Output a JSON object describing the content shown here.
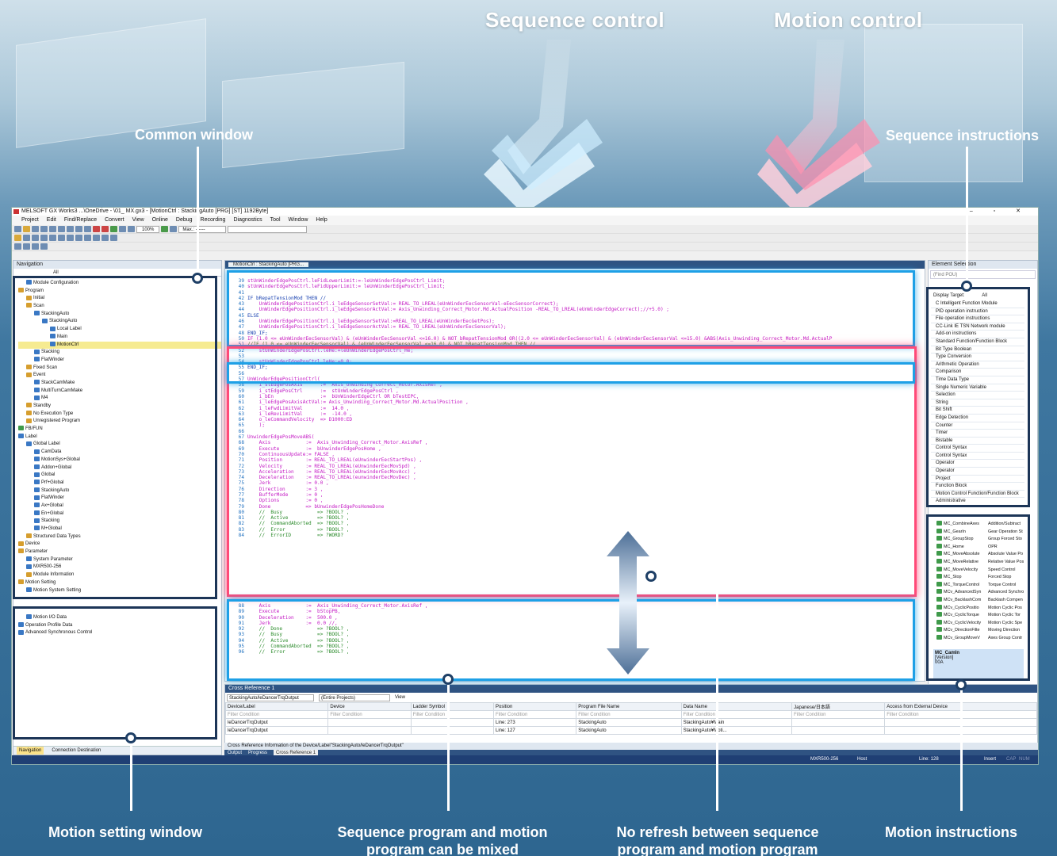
{
  "headings": {
    "sequence_control": "Sequence control",
    "motion_control": "Motion control"
  },
  "callouts": {
    "common_window": "Common window",
    "sequence_instructions": "Sequence instructions",
    "motion_setting_window": "Motion setting window",
    "mixed_program": [
      "Sequence program and motion",
      "program can be mixed"
    ],
    "no_refresh": [
      "No refresh between sequence",
      "program and motion program"
    ],
    "motion_instructions": "Motion instructions"
  },
  "window": {
    "title": "MELSOFT GX Works3 ...\\OneDrive -                    \\01_                      MX.gx3 - [MotionCtrl : StackingAuto [PRG] [ST] 1192Byte]",
    "menu": [
      "Project",
      "Edit",
      "Find/Replace",
      "Convert",
      "View",
      "Online",
      "Debug",
      "Recording",
      "Diagnostics",
      "Tool",
      "Window",
      "Help"
    ],
    "zoom": "100%",
    "max_label": "Max.: ------",
    "controls": [
      "–",
      "▫",
      "✕"
    ]
  },
  "navigation": {
    "title": "Navigation",
    "search": "All",
    "items": [
      {
        "label": "Module Configuration",
        "indent": 1,
        "icon": "b"
      },
      {
        "label": "Program",
        "indent": 0,
        "icon": "y"
      },
      {
        "label": "Initial",
        "indent": 1,
        "icon": "y"
      },
      {
        "label": "Scan",
        "indent": 1,
        "icon": "y"
      },
      {
        "label": "StackingAuto",
        "indent": 2,
        "icon": "b"
      },
      {
        "label": "StackingAuto",
        "indent": 3,
        "icon": "b"
      },
      {
        "label": "Local Label",
        "indent": 4,
        "icon": "b"
      },
      {
        "label": "Main",
        "indent": 4,
        "icon": "b"
      },
      {
        "label": "MotionCtrl",
        "indent": 4,
        "icon": "b",
        "selected": true
      },
      {
        "label": "Stacking",
        "indent": 2,
        "icon": "b"
      },
      {
        "label": "FlatWinder",
        "indent": 2,
        "icon": "b"
      },
      {
        "label": "Fixed Scan",
        "indent": 1,
        "icon": "y"
      },
      {
        "label": "Event",
        "indent": 1,
        "icon": "y"
      },
      {
        "label": "StackCamMake",
        "indent": 2,
        "icon": "b"
      },
      {
        "label": "MultiTurnCamMake",
        "indent": 2,
        "icon": "b"
      },
      {
        "label": "M4",
        "indent": 2,
        "icon": "b"
      },
      {
        "label": "Standby",
        "indent": 1,
        "icon": "y"
      },
      {
        "label": "No Execution Type",
        "indent": 1,
        "icon": "y"
      },
      {
        "label": "Unregistered Program",
        "indent": 1,
        "icon": "y"
      },
      {
        "label": "FB/FUN",
        "indent": 0,
        "icon": "g"
      },
      {
        "label": "Label",
        "indent": 0,
        "icon": "b"
      },
      {
        "label": "Global Label",
        "indent": 1,
        "icon": "b"
      },
      {
        "label": "CamData",
        "indent": 2,
        "icon": "b"
      },
      {
        "label": "MotionSys+Global",
        "indent": 2,
        "icon": "b"
      },
      {
        "label": "Addon+Global",
        "indent": 2,
        "icon": "b"
      },
      {
        "label": "Global",
        "indent": 2,
        "icon": "b"
      },
      {
        "label": "Prf+Global",
        "indent": 2,
        "icon": "b"
      },
      {
        "label": "StackingAuto",
        "indent": 2,
        "icon": "b"
      },
      {
        "label": "FlatWinder",
        "indent": 2,
        "icon": "b"
      },
      {
        "label": "Ax+Global",
        "indent": 2,
        "icon": "b"
      },
      {
        "label": "En+Global",
        "indent": 2,
        "icon": "b"
      },
      {
        "label": "Stacking",
        "indent": 2,
        "icon": "b"
      },
      {
        "label": "M+Global",
        "indent": 2,
        "icon": "b"
      },
      {
        "label": "Structured Data Types",
        "indent": 1,
        "icon": "y"
      },
      {
        "label": "Device",
        "indent": 0,
        "icon": "y"
      },
      {
        "label": "Parameter",
        "indent": 0,
        "icon": "y"
      },
      {
        "label": "System Parameter",
        "indent": 1,
        "icon": "b"
      },
      {
        "label": "MXR500-256",
        "indent": 1,
        "icon": "b"
      },
      {
        "label": "Module Information",
        "indent": 1,
        "icon": "y"
      },
      {
        "label": "Motion Setting",
        "indent": 0,
        "icon": "y"
      },
      {
        "label": "Motion System Setting",
        "indent": 1,
        "icon": "b"
      }
    ],
    "motion_items": [
      {
        "label": "Motion I/O Data",
        "indent": 1
      },
      {
        "label": "Operation Profile Data",
        "indent": 0
      },
      {
        "label": "Advanced Synchronous Control",
        "indent": 0
      }
    ],
    "bottom_tabs": [
      "Navigation",
      "Connection Destination"
    ]
  },
  "editor": {
    "tab": "MotionCtrl : StackingAuto [PRG...",
    "lines": [
      {
        "n": "39",
        "t": "stUnWinderEdgePosCtrl.leFidLowerLimit:=-leUnWinderEdgePosCtrl_Limit;"
      },
      {
        "n": "40",
        "t": "stUnWinderEdgePosCtrl.leFidUpperLimit:= leUnWinderEdgePosCtrl_Limit;"
      },
      {
        "n": "41",
        "t": ""
      },
      {
        "n": "42",
        "t": "IF bRepatTensionMod THEN //",
        "k": true
      },
      {
        "n": "43",
        "t": "    UnWinderEdgePositionCtrl.i_leEdgeSensorSetVal:= REAL_TO_LREAL(eUnWinderEecSensorVal-eEecSensorCorrect);"
      },
      {
        "n": "44",
        "t": "    UnWinderEdgePositionCtrl.i_leEdgeSensorActVal:= Axis_Unwinding_Correct_Motor.Md.ActualPosition -REAL_TO_LREAL(eUnWinderEdgeCorrect);//+5.0) ;"
      },
      {
        "n": "45",
        "t": "ELSE",
        "k": true
      },
      {
        "n": "46",
        "t": "    UnWinderEdgePositionCtrl.i_leEdgeSensorSetVal:=REAL_TO_LREAL(eUnWinderEecGetPos);"
      },
      {
        "n": "47",
        "t": "    UnWinderEdgePositionCtrl.i_leEdgeSensorActVal:= REAL_TO_LREAL(eUnWinderEecSensorVal);"
      },
      {
        "n": "48",
        "t": "END_IF;",
        "k": true
      },
      {
        "n": "50",
        "t": "IF (1.0 <= eUnWinderEecSensorVal) & (eUnWinderEecSensorVal <=16.0) & NOT bRepatTensionMod OR((2.0 <= eUnWinderEecSensorVal) & (eUnWinderEecSensorVal <=15.0) &ABS(Axis_Unwinding_Correct_Motor.Md.ActualP"
      },
      {
        "n": "51",
        "t": "//IF (1.0 <= eUnWinderEecSensorVal) & (eUnWinderEecSensorVal <=16.0) & NOT bRepatTensionMod THEN //",
        "c": true
      },
      {
        "n": "52",
        "t": "    stUnWinderEdgePosCtrl.leHe:=leUnWinderEdgePosCtrl_He;"
      },
      {
        "n": "53",
        "t": ""
      },
      {
        "n": "54",
        "t": "    stUnWinderEdgePosCtrl.leHe:=0.0;"
      },
      {
        "n": "55",
        "t": "END_IF;",
        "k": true
      },
      {
        "n": "56",
        "t": ""
      },
      {
        "n": "57",
        "t": "UnWinderEdgePositionCtrl("
      },
      {
        "n": "58",
        "t": "    i_stEdgePosAxis      :=  Axis_Unwinding_Correct_Motor.AxisRef ,"
      },
      {
        "n": "59",
        "t": "    i_stEdgePosCtrl      :=  stUnWinderEdgePosCtrl ,"
      },
      {
        "n": "60",
        "t": "    i_bEn                :=  bUnWinderEdgeCtrl OR bTestEPC,"
      },
      {
        "n": "61",
        "t": "    i_leEdgePosAxisActVal:= Axis_Unwinding_Correct_Motor.Md.ActualPosition ,"
      },
      {
        "n": "62",
        "t": "    i_leFwdLimitVal      :=  14.0 ,"
      },
      {
        "n": "63",
        "t": "    i_leRevLimitVal      :=  -14.0 ,"
      },
      {
        "n": "64",
        "t": "    o_leCommandVelocity  => D1000:ED"
      },
      {
        "n": "65",
        "t": "    );"
      },
      {
        "n": "66",
        "t": ""
      },
      {
        "n": "67",
        "t": "UnwinderEdgePosMoveABS("
      },
      {
        "n": "68",
        "t": "    Axis            :=  Axis_Unwinding_Correct_Motor.AxisRef ,"
      },
      {
        "n": "69",
        "t": "    Execute         :=  bUnwinderEdgePosHome ,"
      },
      {
        "n": "70",
        "t": "    ContinuousUpdate:= FALSE ,"
      },
      {
        "n": "71",
        "t": "    Position        := REAL_TO_LREAL(eUnwinderEecStartPos) ,"
      },
      {
        "n": "72",
        "t": "    Velocity        := REAL_TO_LREAL(eUnwinderEecMovSpd) ,"
      },
      {
        "n": "73",
        "t": "    Acceleration    := REAL_TO_LREAL(eUnwinderEecMovAcc) ,"
      },
      {
        "n": "74",
        "t": "    Deceleration    := REAL_TO_LREAL(eunwinderEecMovDec) ,"
      },
      {
        "n": "75",
        "t": "    Jerk            := 0.0 ,"
      },
      {
        "n": "76",
        "t": "    Direction       := 3 ,"
      },
      {
        "n": "77",
        "t": "    BufferMode      := 0 ,"
      },
      {
        "n": "78",
        "t": "    Options         := 0 ,"
      },
      {
        "n": "79",
        "t": "    Done            => bUnwinderEdgePosHomeDone"
      },
      {
        "n": "80",
        "t": "    //  Busy            => ?BOOL? ,",
        "c": true
      },
      {
        "n": "81",
        "t": "    //  Active          => ?BOOL? ,",
        "c": true
      },
      {
        "n": "82",
        "t": "    //  CommandAborted  => ?BOOL? ,",
        "c": true
      },
      {
        "n": "83",
        "t": "    //  Error           => ?BOOL? ,",
        "c": true
      },
      {
        "n": "84",
        "t": "    //  ErrorID         => ?WORD?",
        "c": true
      }
    ],
    "lines2": [
      {
        "n": "88",
        "t": "    Axis            :=  Axis_Unwinding_Correct_Motor.AxisRef ,"
      },
      {
        "n": "89",
        "t": "    Execute         :=  bStopPB,"
      },
      {
        "n": "90",
        "t": "    Deceleration    :=  500.0 ,"
      },
      {
        "n": "91",
        "t": "    Jerk            :=  0.0 //,"
      },
      {
        "n": "92",
        "t": "    //  Done            => ?BOOL? ,",
        "c": true
      },
      {
        "n": "93",
        "t": "    //  Busy            => ?BOOL? ,",
        "c": true
      },
      {
        "n": "94",
        "t": "    //  Active          => ?BOOL? ,",
        "c": true
      },
      {
        "n": "95",
        "t": "    //  CommandAborted  => ?BOOL? ,",
        "c": true
      },
      {
        "n": "96",
        "t": "    //  Error           => ?BOOL? ,",
        "c": true
      }
    ]
  },
  "element_selection": {
    "title": "Element Selection",
    "find_placeholder": "(Find POU)",
    "display_target_label": "Display Target:",
    "display_target_value": "All",
    "seq_items": [
      "C Intelligent Function Module",
      "PID operation instruction",
      "File operation instructions",
      "CC-Link IE TSN Network module",
      "Add-on instructions",
      "Standard Function/Function Block",
      "Bit Type Boolean",
      "Type Conversion",
      "Arithmetic Operation",
      "Comparison",
      "Time Data Type",
      "Single Numeric Variable",
      "Selection",
      "String",
      "Bit Shift",
      "Edge Detection",
      "Counter",
      "Timer",
      "Bistable",
      "Control Syntax",
      "Control Syntax",
      "Operator",
      "Operator",
      "Project",
      "Function Block",
      "Motion Control Function/Function Block",
      "Administrative"
    ],
    "motion_items": [
      [
        "MC_CombineAxes",
        "Addition/Subtract"
      ],
      [
        "MC_GearIn",
        "Gear Operation St"
      ],
      [
        "MC_GroupStop",
        "Group Forced Sto"
      ],
      [
        "MC_Home",
        "OPR"
      ],
      [
        "MC_MoveAbsolute",
        "Absolute Value Po"
      ],
      [
        "MC_MoveRelative",
        "Relative Value Pos"
      ],
      [
        "MC_MoveVelocity",
        "Speed Control"
      ],
      [
        "MC_Stop",
        "Forced Stop"
      ],
      [
        "MC_TorqueControl",
        "Torque Control"
      ],
      [
        "MCv_AdvancedSyn",
        "Advanced Synchro"
      ],
      [
        "MCv_BacklashCom",
        "Backlash Compen"
      ],
      [
        "MCv_CyclicPositio",
        "Motion Cyclic Pos"
      ],
      [
        "MCv_CyclicTorque",
        "Motion Cyclic Tor"
      ],
      [
        "MCv_CyclicVelocity",
        "Motion Cyclic Spe"
      ],
      [
        "MCv_DirectionFilte",
        "Moving Direction"
      ],
      [
        "MCv_GroupMoveV",
        "Axes Group Contr"
      ]
    ],
    "detail_name": "MC_CamIn",
    "detail_version_label": "[Version]",
    "detail_version": "00A"
  },
  "cross_reference": {
    "title": "Cross Reference 1",
    "target": "StackingAuto/leDancerTrqOutput",
    "scope": "(Entire Projects)",
    "view_label": "View",
    "headers": [
      "Device/Label",
      "Device",
      "Ladder Symbol",
      "Position",
      "Program File Name",
      "Data Name",
      "Japanese/日本語",
      "Access from External Device"
    ],
    "filter_text": "Filter Condition",
    "rows": [
      [
        "leDancerTrqOutput",
        "",
        "",
        "Line: 273",
        "StackingAuto",
        "StackingAuto¥Main",
        "",
        ""
      ],
      [
        "leDancerTrqOutput",
        "",
        "",
        "Line: 127",
        "StackingAuto",
        "StackingAuto¥Moti...",
        "",
        ""
      ]
    ],
    "info": "Cross Reference Information of the Device/Label\"StackingAuto/leDancerTrqOutput\"",
    "tabs": [
      "Output",
      "Progress",
      "Cross Reference 1"
    ]
  },
  "status": {
    "cpu": "MXR500-256",
    "host": "Host",
    "line": "Line: 128",
    "insert": "Insert",
    "cap": "CAP",
    "num": "NUM"
  }
}
